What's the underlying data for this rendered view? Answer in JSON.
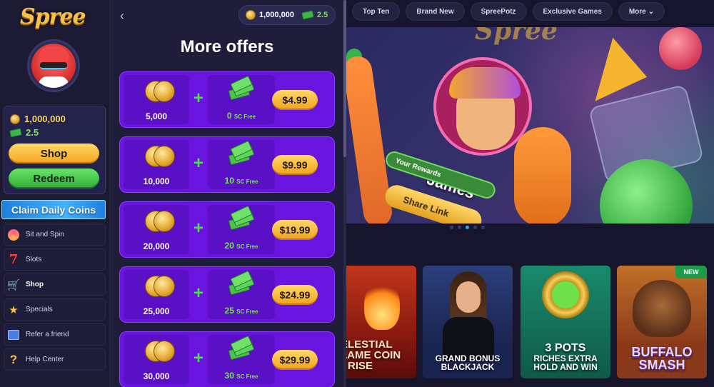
{
  "brand": {
    "name": "Spree"
  },
  "user": {
    "gold_coins": "1,000,000",
    "sweeps_coins": "2.5"
  },
  "sidebar": {
    "shop_label": "Shop",
    "redeem_label": "Redeem",
    "claim_label": "Claim Daily Coins",
    "items": [
      {
        "label": "Sit and Spin",
        "icon": "spin-wheel-icon"
      },
      {
        "label": "Slots",
        "icon": "seven-icon"
      },
      {
        "label": "Shop",
        "icon": "cart-icon",
        "active": true
      },
      {
        "label": "Specials",
        "icon": "star-icon"
      },
      {
        "label": "Refer a friend",
        "icon": "refer-friend-icon"
      },
      {
        "label": "Help Center",
        "icon": "question-icon"
      }
    ]
  },
  "shop": {
    "back_glyph": "‹",
    "balance_gc": "1,000,000",
    "balance_sc": "2.5",
    "title": "More offers",
    "offers": [
      {
        "gc": "5,000",
        "sc": "0",
        "sc_suffix": "SC Free",
        "price": "$4.99"
      },
      {
        "gc": "10,000",
        "sc": "10",
        "sc_suffix": "SC Free",
        "price": "$9.99"
      },
      {
        "gc": "20,000",
        "sc": "20",
        "sc_suffix": "SC Free",
        "price": "$19.99"
      },
      {
        "gc": "25,000",
        "sc": "25",
        "sc_suffix": "SC Free",
        "price": "$24.99"
      },
      {
        "gc": "30,000",
        "sc": "30",
        "sc_suffix": "SC Free",
        "price": "$29.99"
      }
    ]
  },
  "top_nav": {
    "tabs": [
      "Top Ten",
      "Brand New",
      "SpreePotz",
      "Exclusive Games"
    ],
    "more_label": "More"
  },
  "hero": {
    "name": "James",
    "rewards_label": "Your Rewards",
    "share_label": "Share Link",
    "logo_text": "Spree"
  },
  "games": [
    {
      "title_line1": "ELESTIAL",
      "title_line2": "LAME COIN",
      "title_line3": "RISE"
    },
    {
      "title_line1": "GRAND BONUS",
      "title_line2": "BLACKJACK"
    },
    {
      "title_line1": "3 POTS",
      "title_line2": "RICHES EXTRA",
      "title_line3": "HOLD AND WIN"
    },
    {
      "title_line1": "BUFFALO",
      "title_line2": "SMASH",
      "badge": "NEW"
    }
  ],
  "colors": {
    "accent_gold": "#f7c04a",
    "offer_purple": "#6a14e0",
    "sc_green": "#7de35a"
  }
}
